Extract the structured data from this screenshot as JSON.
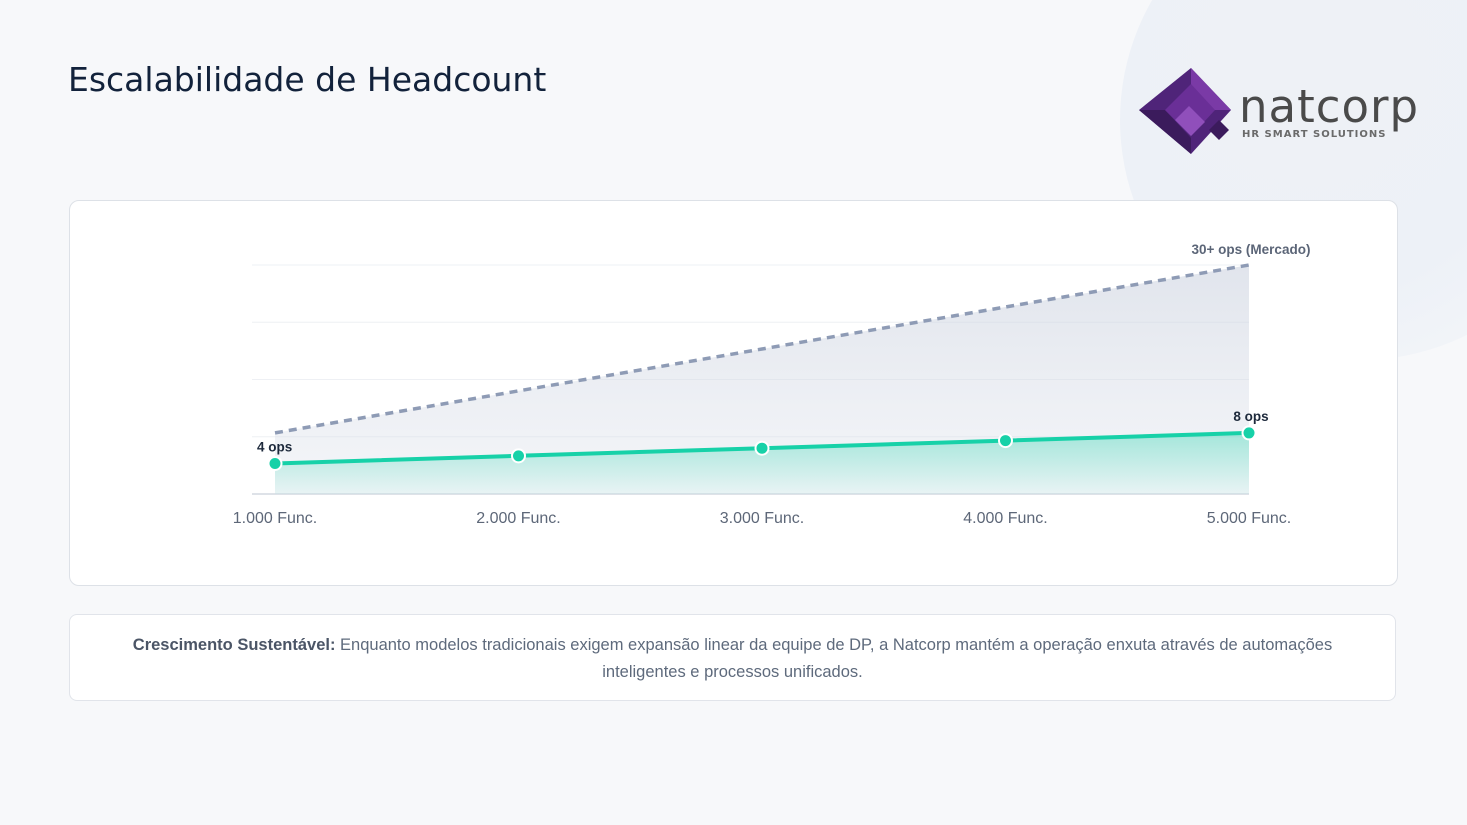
{
  "slide": {
    "title": "Escalabilidade de Headcount"
  },
  "logo": {
    "word": "natcorp",
    "tagline": "HR SMART SOLUTIONS",
    "colors": {
      "primary": "#5b2a86",
      "secondary": "#7b3fa8",
      "accent": "#3a1d5e"
    }
  },
  "note": {
    "label": "Crescimento Sustentável:",
    "text": "Enquanto modelos tradicionais exigem expansão linear da equipe de DP, a Natcorp mantém a operação enxuta através de automações inteligentes e processos unificados."
  },
  "chart_data": {
    "type": "line",
    "categories": [
      "1.000 Func.",
      "2.000 Func.",
      "3.000 Func.",
      "4.000 Func.",
      "5.000 Func."
    ],
    "series": [
      {
        "key": "market",
        "values": [
          8,
          13.5,
          19,
          24.5,
          30
        ],
        "color": "#8e9bb5",
        "dashed": true,
        "fill": "#e6e9f0"
      },
      {
        "key": "natcorp",
        "values": [
          4,
          5,
          6,
          7,
          8
        ],
        "color": "#17d1a8",
        "dashed": false,
        "fill": "#bff2e3"
      }
    ],
    "annotations": [
      {
        "series": "natcorp",
        "index": 0,
        "text": "4 ops"
      },
      {
        "series": "natcorp",
        "index": 4,
        "text": "8 ops"
      },
      {
        "series": "market",
        "index": 4,
        "text": "30+ ops (Mercado)"
      }
    ],
    "ylim": [
      0,
      30
    ],
    "grid": true
  }
}
